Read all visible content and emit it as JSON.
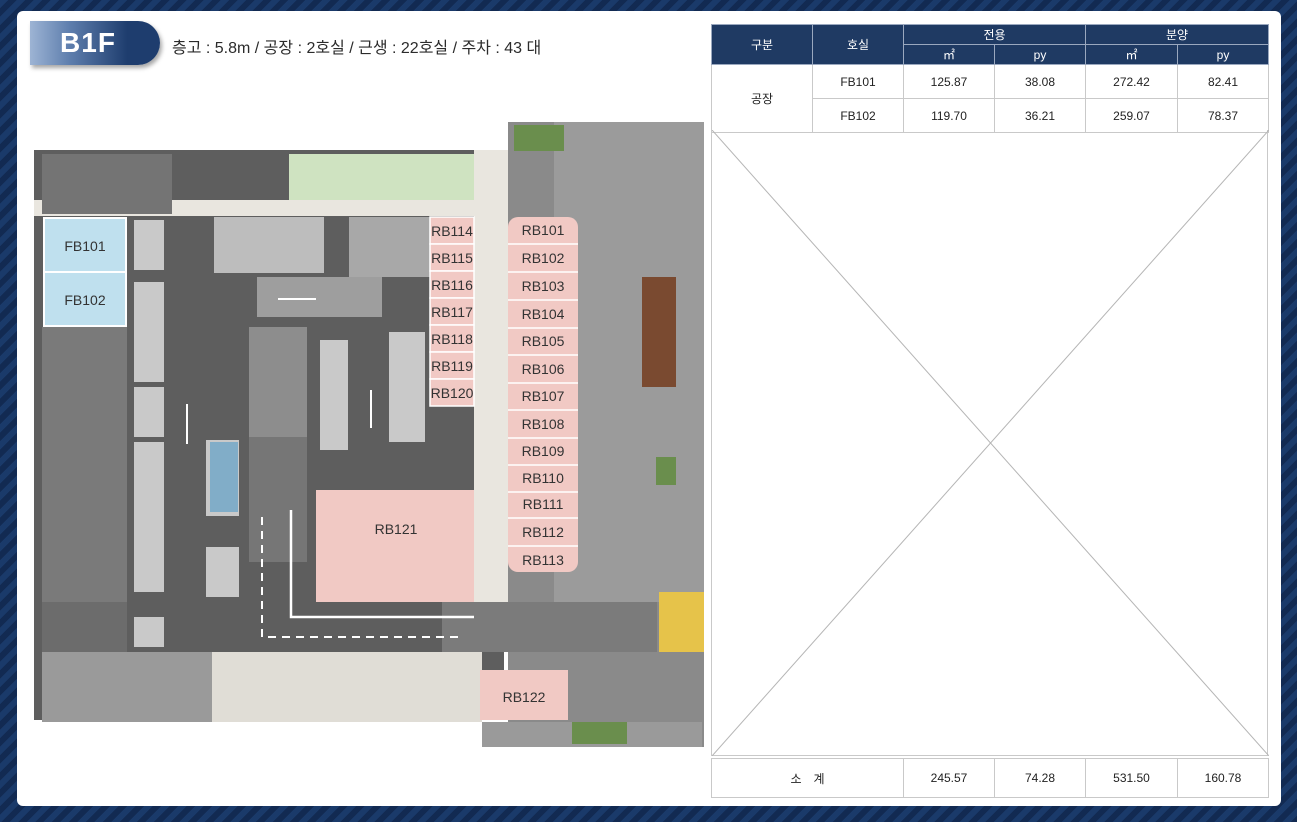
{
  "floor": {
    "label": "B1F",
    "info": "층고 : 5.8m / 공장 : 2호실 / 근생 : 22호실 / 주차 : 43 대"
  },
  "table": {
    "headers": {
      "category": "구분",
      "unit": "호실",
      "exclusive": "전용",
      "sale": "분양",
      "sqm": "㎡",
      "py": "py"
    },
    "group_label": "공장",
    "rows": [
      {
        "unit": "FB101",
        "ex_sqm": "125.87",
        "ex_py": "38.08",
        "sale_sqm": "272.42",
        "sale_py": "82.41"
      },
      {
        "unit": "FB102",
        "ex_sqm": "119.70",
        "ex_py": "36.21",
        "sale_sqm": "259.07",
        "sale_py": "78.37"
      }
    ],
    "subtotal": {
      "label": "소　계",
      "ex_sqm": "245.57",
      "ex_py": "74.28",
      "sale_sqm": "531.50",
      "sale_py": "160.78"
    }
  },
  "plan": {
    "factory_units": [
      "FB101",
      "FB102"
    ],
    "right_units": [
      "RB101",
      "RB102",
      "RB103",
      "RB104",
      "RB105",
      "RB106",
      "RB107",
      "RB108",
      "RB109",
      "RB110",
      "RB111",
      "RB112",
      "RB113"
    ],
    "left_units": [
      "RB114",
      "RB115",
      "RB116",
      "RB117",
      "RB118",
      "RB119",
      "RB120"
    ],
    "large_unit": "RB121",
    "bottom_unit": "RB122"
  },
  "colors": {
    "navy": "#1f3a63",
    "factory": "#bfe0ee",
    "shop": "#f1c9c4",
    "green": "#cfe3c1"
  }
}
